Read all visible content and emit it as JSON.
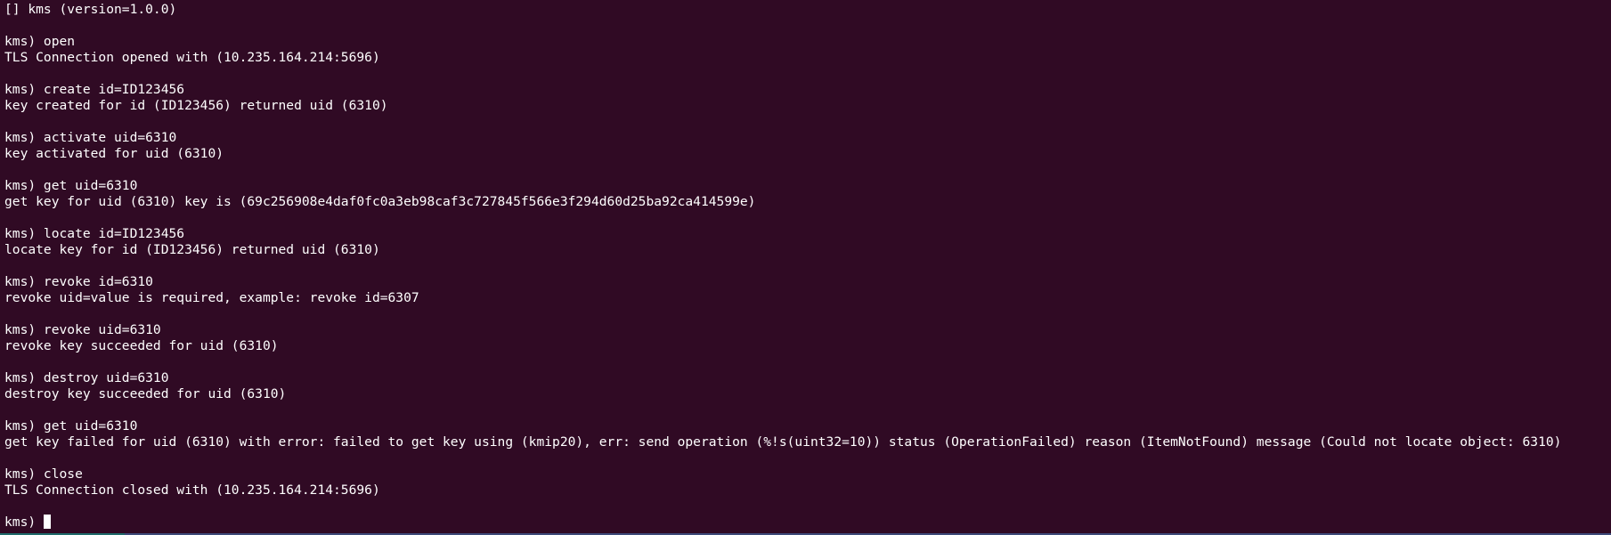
{
  "terminal": {
    "background_color": "#300a24",
    "text_color": "#ffffff",
    "prompt": "kms) ",
    "lines": [
      "[] kms (version=1.0.0)",
      "",
      "kms) open",
      "TLS Connection opened with (10.235.164.214:5696)",
      "",
      "kms) create id=ID123456",
      "key created for id (ID123456) returned uid (6310)",
      "",
      "kms) activate uid=6310",
      "key activated for uid (6310)",
      "",
      "kms) get uid=6310",
      "get key for uid (6310) key is (69c256908e4daf0fc0a3eb98caf3c727845f566e3f294d60d25ba92ca414599e)",
      "",
      "kms) locate id=ID123456",
      "locate key for id (ID123456) returned uid (6310)",
      "",
      "kms) revoke id=6310",
      "revoke uid=value is required, example: revoke id=6307",
      "",
      "kms) revoke uid=6310",
      "revoke key succeeded for uid (6310)",
      "",
      "kms) destroy uid=6310",
      "destroy key succeeded for uid (6310)",
      "",
      "kms) get uid=6310",
      "get key failed for uid (6310) with error: failed to get key using (kmip20), err: send operation (%!s(uint32=10)) status (OperationFailed) reason (ItemNotFound) message (Could not locate object: 6310)",
      "",
      "kms) close",
      "TLS Connection closed with (10.235.164.214:5696)",
      ""
    ]
  }
}
